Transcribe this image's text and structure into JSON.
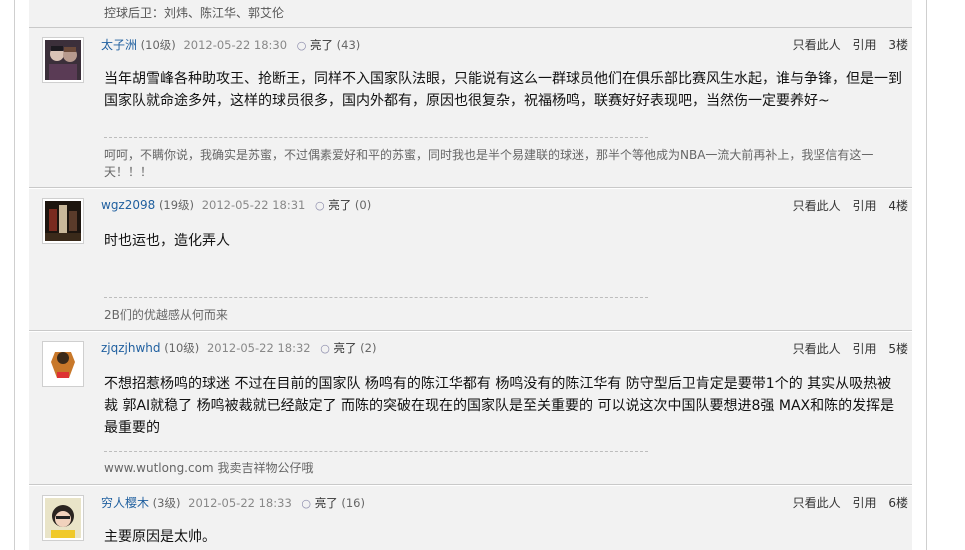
{
  "prev_signature": "控球后卫：刘炜、陈江华、郭艾伦",
  "posts": [
    {
      "username": "太子洲",
      "level": "(10级)",
      "time": "2012-05-22 18:30",
      "light_label": "亮了",
      "light_count": "(43)",
      "action_only": "只看此人",
      "action_quote": "引用",
      "floor": "3楼",
      "content": "当年胡雪峰各种助攻王、抢断王，同样不入国家队法眼，只能说有这么一群球员他们在俱乐部比赛风生水起，谁与争锋，但是一到国家队就命途多舛，这样的球员很多，国内外都有，原因也很复杂，祝福杨鸣，联赛好好表现吧，当然伤一定要养好~",
      "signature": "呵呵，不瞒你说，我确实是苏蜜，不过偶素爱好和平的苏蜜，同时我也是半个易建联的球迷，那半个等他成为NBA一流大前再补上，我坚信有这一天！！！"
    },
    {
      "username": "wgz2098",
      "level": "(19级)",
      "time": "2012-05-22 18:31",
      "light_label": "亮了",
      "light_count": "(0)",
      "action_only": "只看此人",
      "action_quote": "引用",
      "floor": "4楼",
      "content": "时也运也，造化弄人",
      "signature": "2B们的优越感从何而来"
    },
    {
      "username": "zjqzjhwhd",
      "level": "(10级)",
      "time": "2012-05-22 18:32",
      "light_label": "亮了",
      "light_count": "(2)",
      "action_only": "只看此人",
      "action_quote": "引用",
      "floor": "5楼",
      "content": "不想招惹杨鸣的球迷 不过在目前的国家队 杨鸣有的陈江华都有 杨鸣没有的陈江华有  防守型后卫肯定是要带1个的 其实从吸热被裁 郭AI就稳了 杨鸣被裁就已经敲定了  而陈的突破在现在的国家队是至关重要的 可以说这次中国队要想进8强 MAX和陈的发挥是最重要的",
      "signature": "www.wutlong.com 我卖吉祥物公仔哦"
    },
    {
      "username": "穷人樱木",
      "level": "(3级)",
      "time": "2012-05-22 18:33",
      "light_label": "亮了",
      "light_count": "(16)",
      "action_only": "只看此人",
      "action_quote": "引用",
      "floor": "6楼",
      "content": "主要原因是太帅。",
      "signature": ""
    }
  ],
  "bulb_icon": "lightbulb-icon",
  "colors": {
    "username": "#1f5f9f",
    "post_bg": "#f2f2f2"
  }
}
